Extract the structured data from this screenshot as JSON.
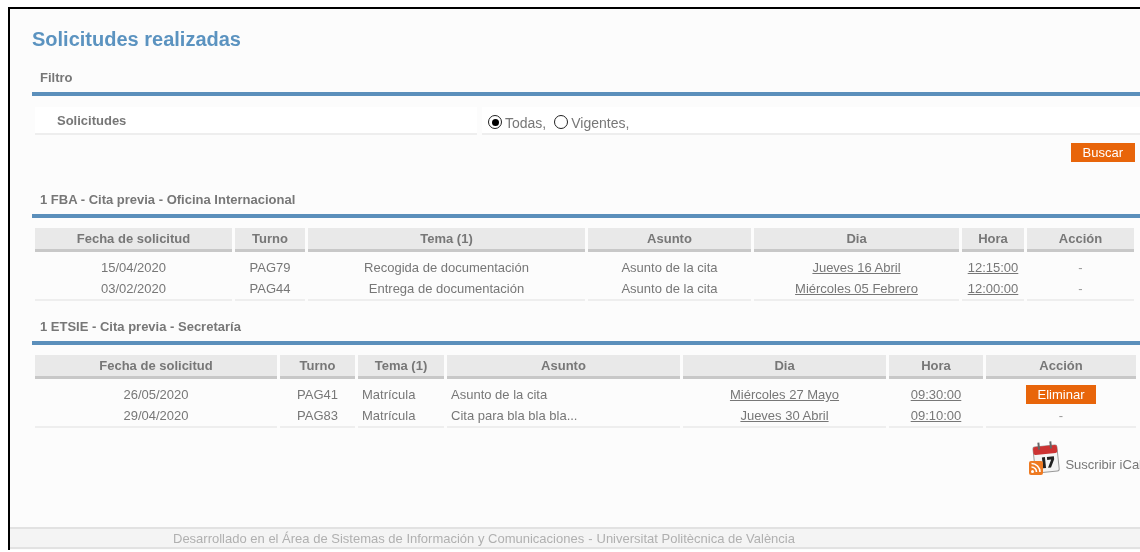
{
  "title": "Solicitudes realizadas",
  "filter": {
    "heading": "Filtro",
    "label": "Solicitudes",
    "options": [
      {
        "label": "Todas,",
        "selected": true
      },
      {
        "label": "Vigentes,",
        "selected": false
      }
    ],
    "button": "Buscar"
  },
  "sections": [
    {
      "heading": "1 FBA - Cita previa - Oficina Internacional",
      "columns": [
        "Fecha de solicitud",
        "Turno",
        "Tema (1)",
        "Asunto",
        "Dia",
        "Hora",
        "Acción"
      ],
      "rows": [
        {
          "date": "15/04/2020",
          "turno": "PAG79",
          "tema": "Recogida de documentación",
          "asunto": "Asunto de la cita",
          "dia": "Jueves 16 Abril",
          "hora": "12:15:00",
          "action": {
            "kind": "text",
            "label": "-"
          }
        },
        {
          "date": "03/02/2020",
          "turno": "PAG44",
          "tema": "Entrega de documentación",
          "asunto": "Asunto de la cita",
          "dia": "Miércoles 05 Febrero",
          "hora": "12:00:00",
          "action": {
            "kind": "text",
            "label": "-"
          }
        }
      ]
    },
    {
      "heading": "1 ETSIE - Cita previa - Secretaría",
      "columns": [
        "Fecha de solicitud",
        "Turno",
        "Tema (1)",
        "Asunto",
        "Dia",
        "Hora",
        "Acción"
      ],
      "rows": [
        {
          "date": "26/05/2020",
          "turno": "PAG41",
          "tema": "Matrícula",
          "asunto": "Asunto de la cita",
          "dia": "Miércoles 27 Mayo",
          "hora": "09:30:00",
          "action": {
            "kind": "button",
            "label": "Eliminar"
          }
        },
        {
          "date": "29/04/2020",
          "turno": "PAG83",
          "tema": "Matrícula",
          "asunto": "Cita para bla bla bla...",
          "dia": "Jueves 30 Abril",
          "hora": "09:10:00",
          "action": {
            "kind": "text",
            "label": "-"
          }
        }
      ]
    }
  ],
  "ical": "Suscribir iCal",
  "footer": {
    "text": "Desarrollado en el Área de Sistemas de Información y Comunicaciones",
    "link": "Universitat Politècnica de València",
    "separator": "-"
  }
}
